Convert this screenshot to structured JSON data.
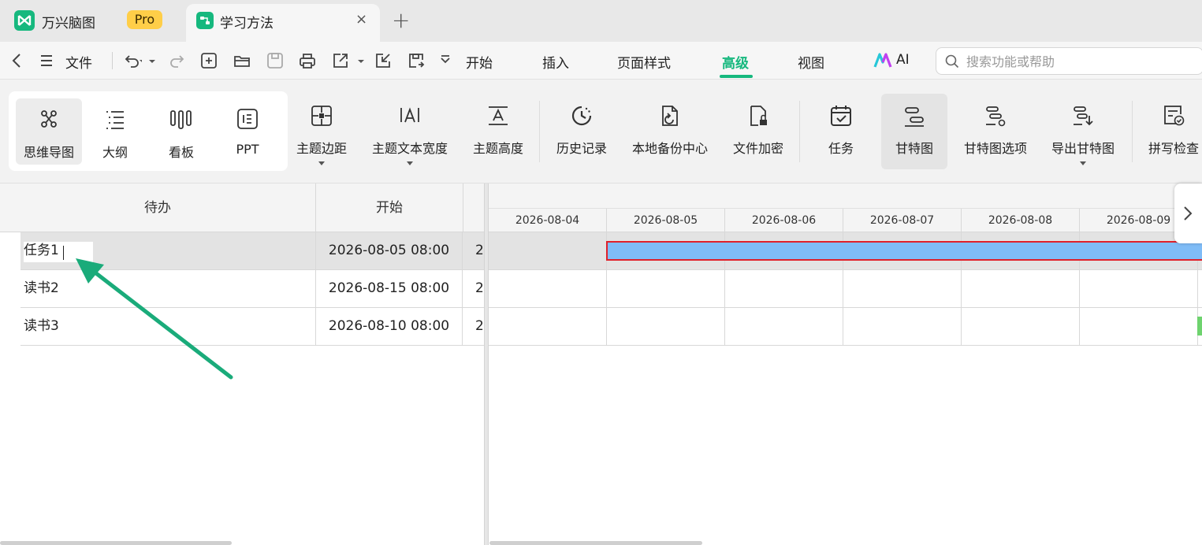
{
  "tabs": {
    "app_name": "万兴脑图",
    "pro_badge": "Pro",
    "doc_title": "学习方法",
    "close_glyph": "×",
    "new_tab_glyph": "+"
  },
  "menu": {
    "file": "文件",
    "items": [
      "开始",
      "插入",
      "页面样式",
      "高级",
      "视图"
    ],
    "active": "高级",
    "ai_label": "AI",
    "search_placeholder": "搜索功能或帮助",
    "accent_color": "#16b87e"
  },
  "toolbar": {
    "views": [
      "思维导图",
      "大纲",
      "看板",
      "PPT"
    ],
    "selected_view": "思维导图",
    "tools": {
      "topic_margin": "主题边距",
      "topic_text_width": "主题文本宽度",
      "topic_height": "主题高度",
      "history": "历史记录",
      "local_backup": "本地备份中心",
      "file_encrypt": "文件加密",
      "task": "任务",
      "gantt": "甘特图",
      "gantt_options": "甘特图选项",
      "export_gantt": "导出甘特图",
      "spell_check": "拼写检查"
    }
  },
  "table": {
    "headers": {
      "todo": "待办",
      "start": "开始"
    },
    "rows": [
      {
        "name": "任务1",
        "start": "2026-08-05 08:00",
        "end": "2"
      },
      {
        "name": "读书2",
        "start": "2026-08-15 08:00",
        "end": "2"
      },
      {
        "name": "读书3",
        "start": "2026-08-10 08:00",
        "end": "2"
      }
    ],
    "editing_row": "任务1"
  },
  "gantt": {
    "days": [
      "2026-08-04",
      "2026-08-05",
      "2026-08-06",
      "2026-08-07",
      "2026-08-08",
      "2026-08-09"
    ],
    "bar_color": "#7fbcf7",
    "bar_border_color": "#e0202a",
    "next_glyph": "›"
  },
  "annotation": {
    "arrow_color": "#1aab7a",
    "arrow_icon": "arrow-pointing-to-task1"
  }
}
